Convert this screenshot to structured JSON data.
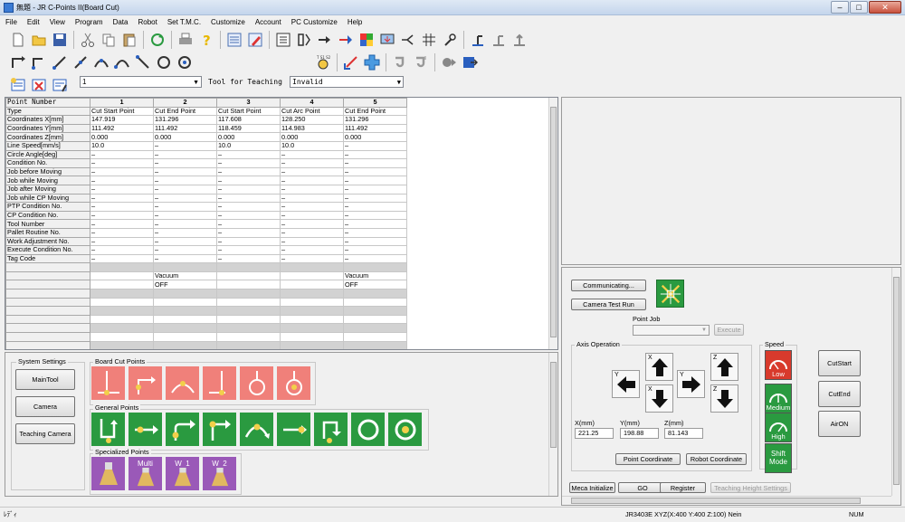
{
  "window": {
    "title": "無題 - JR C-Points II(Board Cut)"
  },
  "menu": [
    "File",
    "Edit",
    "View",
    "Program",
    "Data",
    "Robot",
    "Set T.M.C.",
    "Customize",
    "Account",
    "PC Customize",
    "Help"
  ],
  "point_select": {
    "value": "1"
  },
  "tool_teaching": {
    "label": "Tool for Teaching",
    "value": "Invalid"
  },
  "grid": {
    "header_label": "Point Number",
    "columns": [
      "1",
      "2",
      "3",
      "4",
      "5"
    ],
    "rows": [
      {
        "label": "Type",
        "cells": [
          "Cut Start Point",
          "Cut End Point",
          "Cut Start Point",
          "Cut Arc Point",
          "Cut End Point"
        ]
      },
      {
        "label": "Coordinates X[mm]",
        "cells": [
          "147.919",
          "131.296",
          "117.608",
          "128.250",
          "131.296"
        ]
      },
      {
        "label": "Coordinates Y[mm]",
        "cells": [
          "111.492",
          "111.492",
          "118.459",
          "114.983",
          "111.492"
        ]
      },
      {
        "label": "Coordinates Z[mm]",
        "cells": [
          "0.000",
          "0.000",
          "0.000",
          "0.000",
          "0.000"
        ]
      },
      {
        "label": "Line Speed[mm/s]",
        "cells": [
          "10.0",
          "–",
          "10.0",
          "10.0",
          "–"
        ]
      },
      {
        "label": "Circle Angle[deg]",
        "cells": [
          "–",
          "–",
          "–",
          "–",
          "–"
        ]
      },
      {
        "label": "Condition No.",
        "cells": [
          "–",
          "–",
          "–",
          "–",
          "–"
        ]
      },
      {
        "label": "Job before Moving",
        "cells": [
          "–",
          "–",
          "–",
          "–",
          "–"
        ]
      },
      {
        "label": "Job while Moving",
        "cells": [
          "–",
          "–",
          "–",
          "–",
          "–"
        ]
      },
      {
        "label": "Job after Moving",
        "cells": [
          "–",
          "–",
          "–",
          "–",
          "–"
        ]
      },
      {
        "label": "Job while CP Moving",
        "cells": [
          "–",
          "–",
          "–",
          "–",
          "–"
        ]
      },
      {
        "label": "PTP Condition No.",
        "cells": [
          "–",
          "–",
          "–",
          "–",
          "–"
        ]
      },
      {
        "label": "CP Condition No.",
        "cells": [
          "–",
          "–",
          "–",
          "–",
          "–"
        ]
      },
      {
        "label": "Tool Number",
        "cells": [
          "–",
          "–",
          "–",
          "–",
          "–"
        ]
      },
      {
        "label": "Pallet Routine No.",
        "cells": [
          "–",
          "–",
          "–",
          "–",
          "–"
        ]
      },
      {
        "label": "Work Adjustment No.",
        "cells": [
          "–",
          "–",
          "–",
          "–",
          "–"
        ]
      },
      {
        "label": "Execute Condition No.",
        "cells": [
          "–",
          "–",
          "–",
          "–",
          "–"
        ]
      },
      {
        "label": "Tag Code",
        "cells": [
          "–",
          "–",
          "–",
          "–",
          "–"
        ]
      }
    ],
    "extra_rows": [
      {
        "gray": true,
        "cells": [
          "",
          "",
          "",
          "",
          ""
        ]
      },
      {
        "gray": false,
        "cells": [
          "",
          "Vacuum",
          "",
          "",
          "Vacuum"
        ]
      },
      {
        "gray": false,
        "cells": [
          "",
          "OFF",
          "",
          "",
          "OFF"
        ]
      },
      {
        "gray": true,
        "cells": [
          "",
          "",
          "",
          "",
          ""
        ]
      },
      {
        "gray": false,
        "cells": [
          "",
          "",
          "",
          "",
          ""
        ]
      },
      {
        "gray": true,
        "cells": [
          "",
          "",
          "",
          "",
          ""
        ]
      },
      {
        "gray": false,
        "cells": [
          "",
          "",
          "",
          "",
          ""
        ]
      },
      {
        "gray": true,
        "cells": [
          "",
          "",
          "",
          "",
          ""
        ]
      },
      {
        "gray": false,
        "cells": [
          "",
          "",
          "",
          "",
          ""
        ]
      },
      {
        "gray": true,
        "cells": [
          "",
          "",
          "",
          "",
          ""
        ]
      },
      {
        "gray": false,
        "cells": [
          "",
          "",
          "",
          "",
          ""
        ]
      }
    ]
  },
  "system_settings": {
    "label": "System Settings",
    "buttons": [
      "MainTool",
      "Camera",
      "Teaching Camera"
    ]
  },
  "board_cut_points": {
    "label": "Board Cut Points"
  },
  "general_points": {
    "label": "General Points"
  },
  "specialized_points": {
    "label": "Specialized Points",
    "multi": "Multi",
    "w1": "W",
    "w1n": "1",
    "w2": "W",
    "w2n": "2"
  },
  "control": {
    "communicating": "Communicating...",
    "camera_test": "Camera Test Run",
    "point_job": "Point Job",
    "execute": "Execute",
    "axis_operation": "Axis Operation",
    "axis": {
      "y": "Y",
      "x": "X",
      "z": "Z"
    },
    "x_label": "X(mm)",
    "y_label": "Y(mm)",
    "z_label": "Z(mm)",
    "x_val": "221.25",
    "y_val": "198.88",
    "z_val": "81.143",
    "point_coordinate": "Point Coordinate",
    "robot_coordinate": "Robot Coordinate",
    "speed": "Speed",
    "low": "Low",
    "medium": "Medium",
    "high": "High",
    "shift": "Shift",
    "mode": "Mode",
    "cut_start": "CutStart",
    "cut_end": "CutEnd",
    "air_on": "AirON",
    "meca_init": "Meca Initialize",
    "go": "GO",
    "register": "Register",
    "teaching_height": "Teaching Height Settings"
  },
  "status": {
    "left": "ﾚﾃﾞｨ",
    "robot": "JR3403E XYZ(X:400 Y:400 Z:100) Nein",
    "num": "NUM"
  },
  "colors": {
    "pink": "#f0807a",
    "green": "#2a9a40",
    "purple": "#9a59b8",
    "low": "#d83a2c"
  }
}
